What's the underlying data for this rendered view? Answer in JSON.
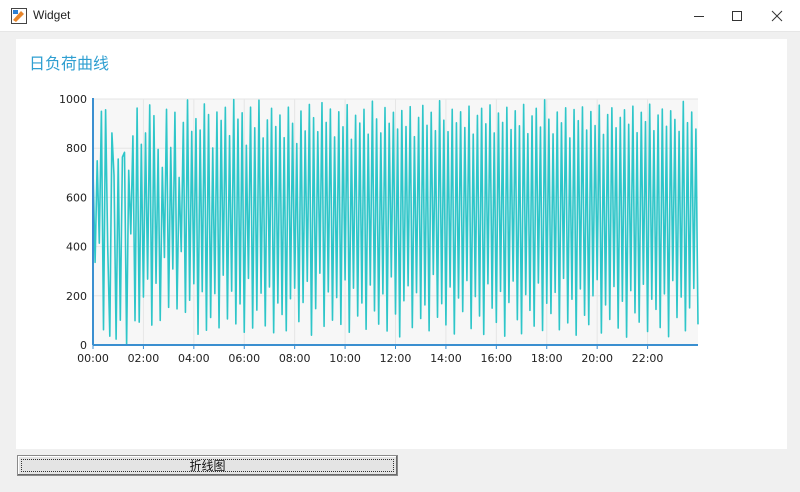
{
  "window": {
    "title": "Widget"
  },
  "chart_title": "日负荷曲线",
  "button": {
    "label": "折线图"
  },
  "colors": {
    "accent_title": "#2f9fd1",
    "series": "#2ec6c9",
    "axis": "#3a8fd0"
  },
  "chart_data": {
    "type": "line",
    "title": "日负荷曲线",
    "xlabel": "",
    "ylabel": "",
    "ylim": [
      0,
      1000
    ],
    "y_ticks": [
      0,
      200,
      400,
      600,
      800,
      1000
    ],
    "x_ticks": [
      "00:00",
      "02:00",
      "04:00",
      "06:00",
      "08:00",
      "10:00",
      "12:00",
      "14:00",
      "16:00",
      "18:00",
      "20:00",
      "22:00"
    ],
    "xlim_hours": [
      0,
      24
    ],
    "grid": true,
    "legend": "none",
    "series": [
      {
        "sample_interval_minutes": 5,
        "values": [
          714,
          336,
          749,
          414,
          950,
          62,
          956,
          402,
          36,
          862,
          690,
          24,
          756,
          101,
          764,
          783,
          0,
          710,
          452,
          850,
          99,
          963,
          93,
          816,
          195,
          862,
          268,
          976,
          81,
          932,
          251,
          795,
          100,
          722,
          356,
          958,
          153,
          803,
          309,
          946,
          147,
          681,
          380,
          905,
          133,
          996,
          182,
          868,
          249,
          920,
          44,
          874,
          217,
          980,
          60,
          937,
          112,
          801,
          209,
          947,
          70,
          913,
          284,
          966,
          106,
          851,
          219,
          998,
          86,
          918,
          167,
          944,
          52,
          812,
          271,
          967,
          69,
          883,
          142,
          995,
          211,
          842,
          78,
          915,
          236,
          962,
          50,
          888,
          171,
          935,
          124,
          843,
          58,
          967,
          188,
          901,
          231,
          819,
          95,
          951,
          173,
          870,
          259,
          978,
          40,
          924,
          148,
          867,
          292,
          985,
          76,
          905,
          216,
          959,
          101,
          846,
          193,
          948,
          84,
          887,
          265,
          977,
          52,
          836,
          231,
          934,
          118,
          902,
          171,
          958,
          64,
          857,
          244,
          991,
          139,
          919,
          85,
          862,
          208,
          965,
          57,
          901,
          277,
          946,
          126,
          878,
          33,
          953,
          180,
          888,
          241,
          969,
          71,
          847,
          213,
          925,
          108,
          974,
          163,
          893,
          58,
          946,
          287,
          871,
          113,
          993,
          168,
          914,
          82,
          867,
          236,
          958,
          45,
          903,
          191,
          948,
          136,
          884,
          262,
          971,
          67,
          857,
          197,
          933,
          118,
          962,
          43,
          899,
          249,
          976,
          150,
          862,
          92,
          943,
          218,
          905,
          36,
          966,
          173,
          876,
          260,
          952,
          103,
          891,
          46,
          978,
          205,
          859,
          141,
          931,
          77,
          962,
          252,
          886,
          59,
          997,
          170,
          918,
          128,
          858,
          214,
          947,
          62,
          903,
          271,
          964,
          90,
          842,
          186,
          957,
          40,
          912,
          228,
          968,
          121,
          874,
          83,
          949,
          200,
          892,
          266,
          975,
          49,
          856,
          163,
          937,
          104,
          964,
          238,
          883,
          69,
          925,
          178,
          956,
          32,
          897,
          221,
          971,
          131,
          863,
          93,
          946,
          247,
          908,
          55,
          979,
          186,
          871,
          145,
          935,
          71,
          959,
          208,
          889,
          34,
          952,
          262,
          917,
          112,
          868,
          195,
          990,
          58,
          904,
          151,
          947,
          230,
          878,
          84,
          961,
          42,
          886,
          179,
          927,
          111,
          968,
          244,
          859,
          67,
          915,
          203,
          983,
          130,
          892,
          54,
          945,
          186,
          918,
          96,
          970,
          237,
          874,
          61,
          939,
          152,
          988,
          205,
          862,
          78,
          908,
          261,
          947,
          39,
          981,
          168,
          896,
          118,
          953,
          217,
          868,
          49,
          924,
          174,
          966,
          92,
          882,
          256,
          940,
          63,
          905,
          197,
          987,
          137,
          872,
          86,
          951,
          232,
          917,
          44,
          934,
          185,
          860,
          109,
          976,
          247,
          899,
          68,
          918,
          161,
          962,
          80,
          858,
          276,
          944,
          37,
          906,
          211,
          971,
          125,
          883,
          58,
          928,
          188,
          949,
          104,
          864,
          239,
          998,
          50,
          893,
          173,
          931,
          86,
          963,
          248,
          878,
          45,
          915,
          198,
          958,
          116,
          869,
          62,
          946,
          213,
          891,
          34,
          986,
          154,
          902,
          93,
          941,
          260,
          873,
          56,
          930,
          189,
          967,
          122,
          855,
          72,
          921,
          241,
          959,
          43,
          887,
          176,
          984,
          109,
          866,
          224,
          948,
          61,
          903,
          139,
          938,
          201,
          172,
          618,
          225,
          689,
          444,
          882,
          310,
          480
        ]
      }
    ]
  }
}
